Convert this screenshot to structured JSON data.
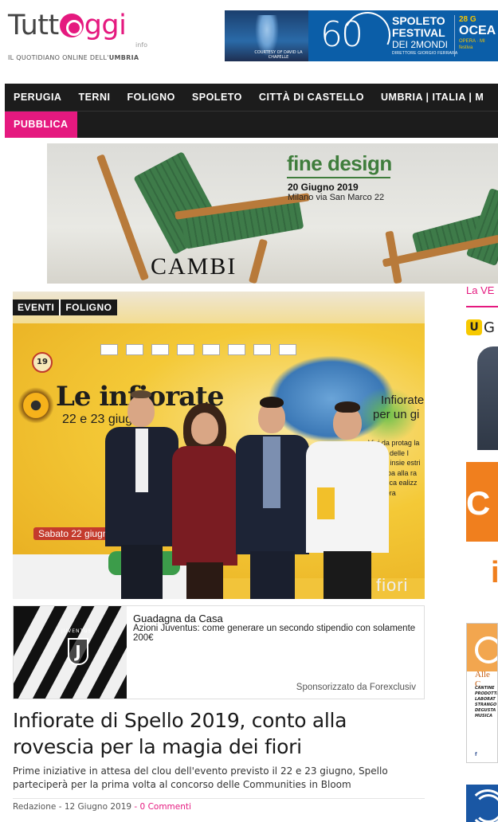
{
  "header": {
    "logo": {
      "text_start": "Tutt",
      "text_end": "ggi",
      "suffix": "info",
      "tagline_prefix": "IL QUOTIDIANO ONLINE DELL'",
      "tagline_region": "UMBRIA"
    },
    "banner": {
      "courtesy": "COURTESY OF DAVID LA CHAPELLE",
      "number": "60",
      "festival_l1": "SPOLETO",
      "festival_l2": "FESTIVAL",
      "festival_l3": "DEI 2MONDI",
      "director": "DIRETTORE GIORGIO FERRARA",
      "date": "28 G",
      "right_title": "OCEA",
      "right_sub1": "OPERA · MI",
      "right_sub2": "festiva"
    }
  },
  "nav": {
    "items": [
      "PERUGIA",
      "TERNI",
      "FOLIGNO",
      "SPOLETO",
      "CITTÀ DI CASTELLO",
      "UMBRIA | ITALIA | M"
    ],
    "second_row": [
      "PUBBLICA"
    ]
  },
  "ad_top": {
    "title": "fine design",
    "date": "20 Giugno 2019",
    "place": "Milano via San Marco 22",
    "brand": "CAMBI"
  },
  "article": {
    "categories": [
      "EVENTI",
      "FOLIGNO"
    ],
    "image_text": {
      "badge": "19",
      "title": "Le infiorate",
      "dates": "22 e 23 giugno",
      "right_l1": "Infiorate",
      "right_l2": "per un gi",
      "side_text": "Vivi da protag la magia delle I Spello insie estri infior ipa alla ra a, alla ca ealizz un'opera",
      "sabato": "Sabato 22 giugno",
      "fiori": "fiori"
    },
    "sponsored": {
      "title": "Guadagna da Casa",
      "subtitle": "Azioni Juventus: come generare un secondo stipendio con solamente 200€",
      "by": "Sponsorizzato da Forexclusiv",
      "image_text": "JUVENTUS"
    },
    "headline": "Infiorate di Spello 2019, conto alla rovescia per la magia dei fiori",
    "excerpt": "Prime iniziative in attesa del clou dell'evento previsto il 22 e 23 giugno, Spello parteciperà per la prima volta al concorso delle Communities in Bloom",
    "author": "Redazione",
    "date": "12 Giugno 2019",
    "comments": "0 Commenti"
  },
  "sidebar": {
    "title": "La VE",
    "ad1_letter": "U",
    "ad1_text": "G",
    "ad2_letter": "C",
    "ad3_letter": "i",
    "ad4_title": "Alle C",
    "ad4_lines": "CANTINE PRODOTTI LABORAT STRANGO DEGUSTA MUSICA",
    "ad4_social": "f"
  },
  "colors": {
    "accent": "#e5197f",
    "nav_bg": "#1c1c1c"
  }
}
